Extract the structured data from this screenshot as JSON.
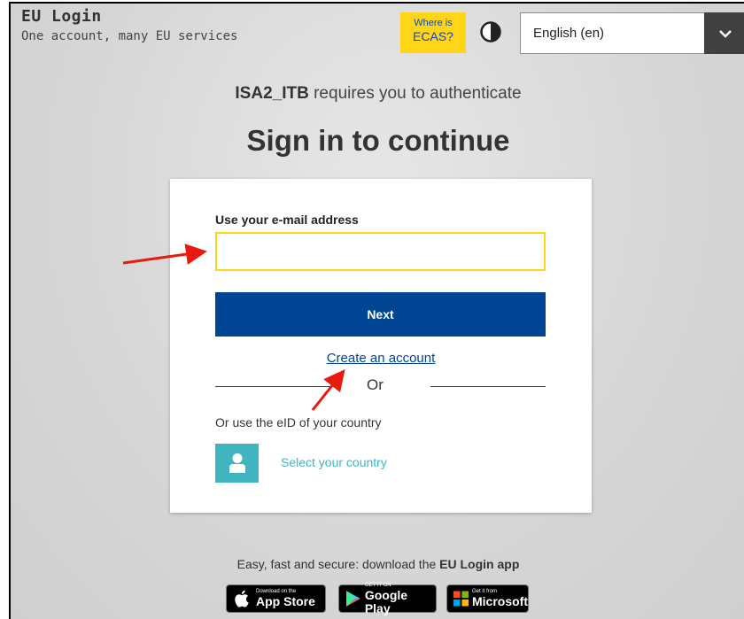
{
  "header": {
    "title": "EU Login",
    "subtitle": "One account, many EU services",
    "ecas_line1": "Where is",
    "ecas_line2": "ECAS?",
    "language": "English (en)"
  },
  "auth": {
    "app_name": "ISA2_ITB",
    "requires_text": " requires you to authenticate",
    "heading": "Sign in to continue"
  },
  "form": {
    "email_label": "Use your e-mail address",
    "email_value": "",
    "next_label": "Next",
    "create_account": "Create an account",
    "or_text": "Or",
    "eid_label": "Or use the eID of your country",
    "select_country": "Select your country"
  },
  "footer": {
    "download_prefix": "Easy, fast and secure: download the ",
    "download_app": "EU Login app",
    "stores": {
      "apple_small": "Download on the",
      "apple_big": "App Store",
      "google_small": "GET IT ON",
      "google_big": "Google Play",
      "microsoft_small": "Get it from",
      "microsoft_big": "Microsoft"
    }
  },
  "colors": {
    "accent_blue": "#004494",
    "ecas_yellow": "#ffd617",
    "eid_teal": "#40b5bf",
    "annotation_red": "#e8190f"
  }
}
